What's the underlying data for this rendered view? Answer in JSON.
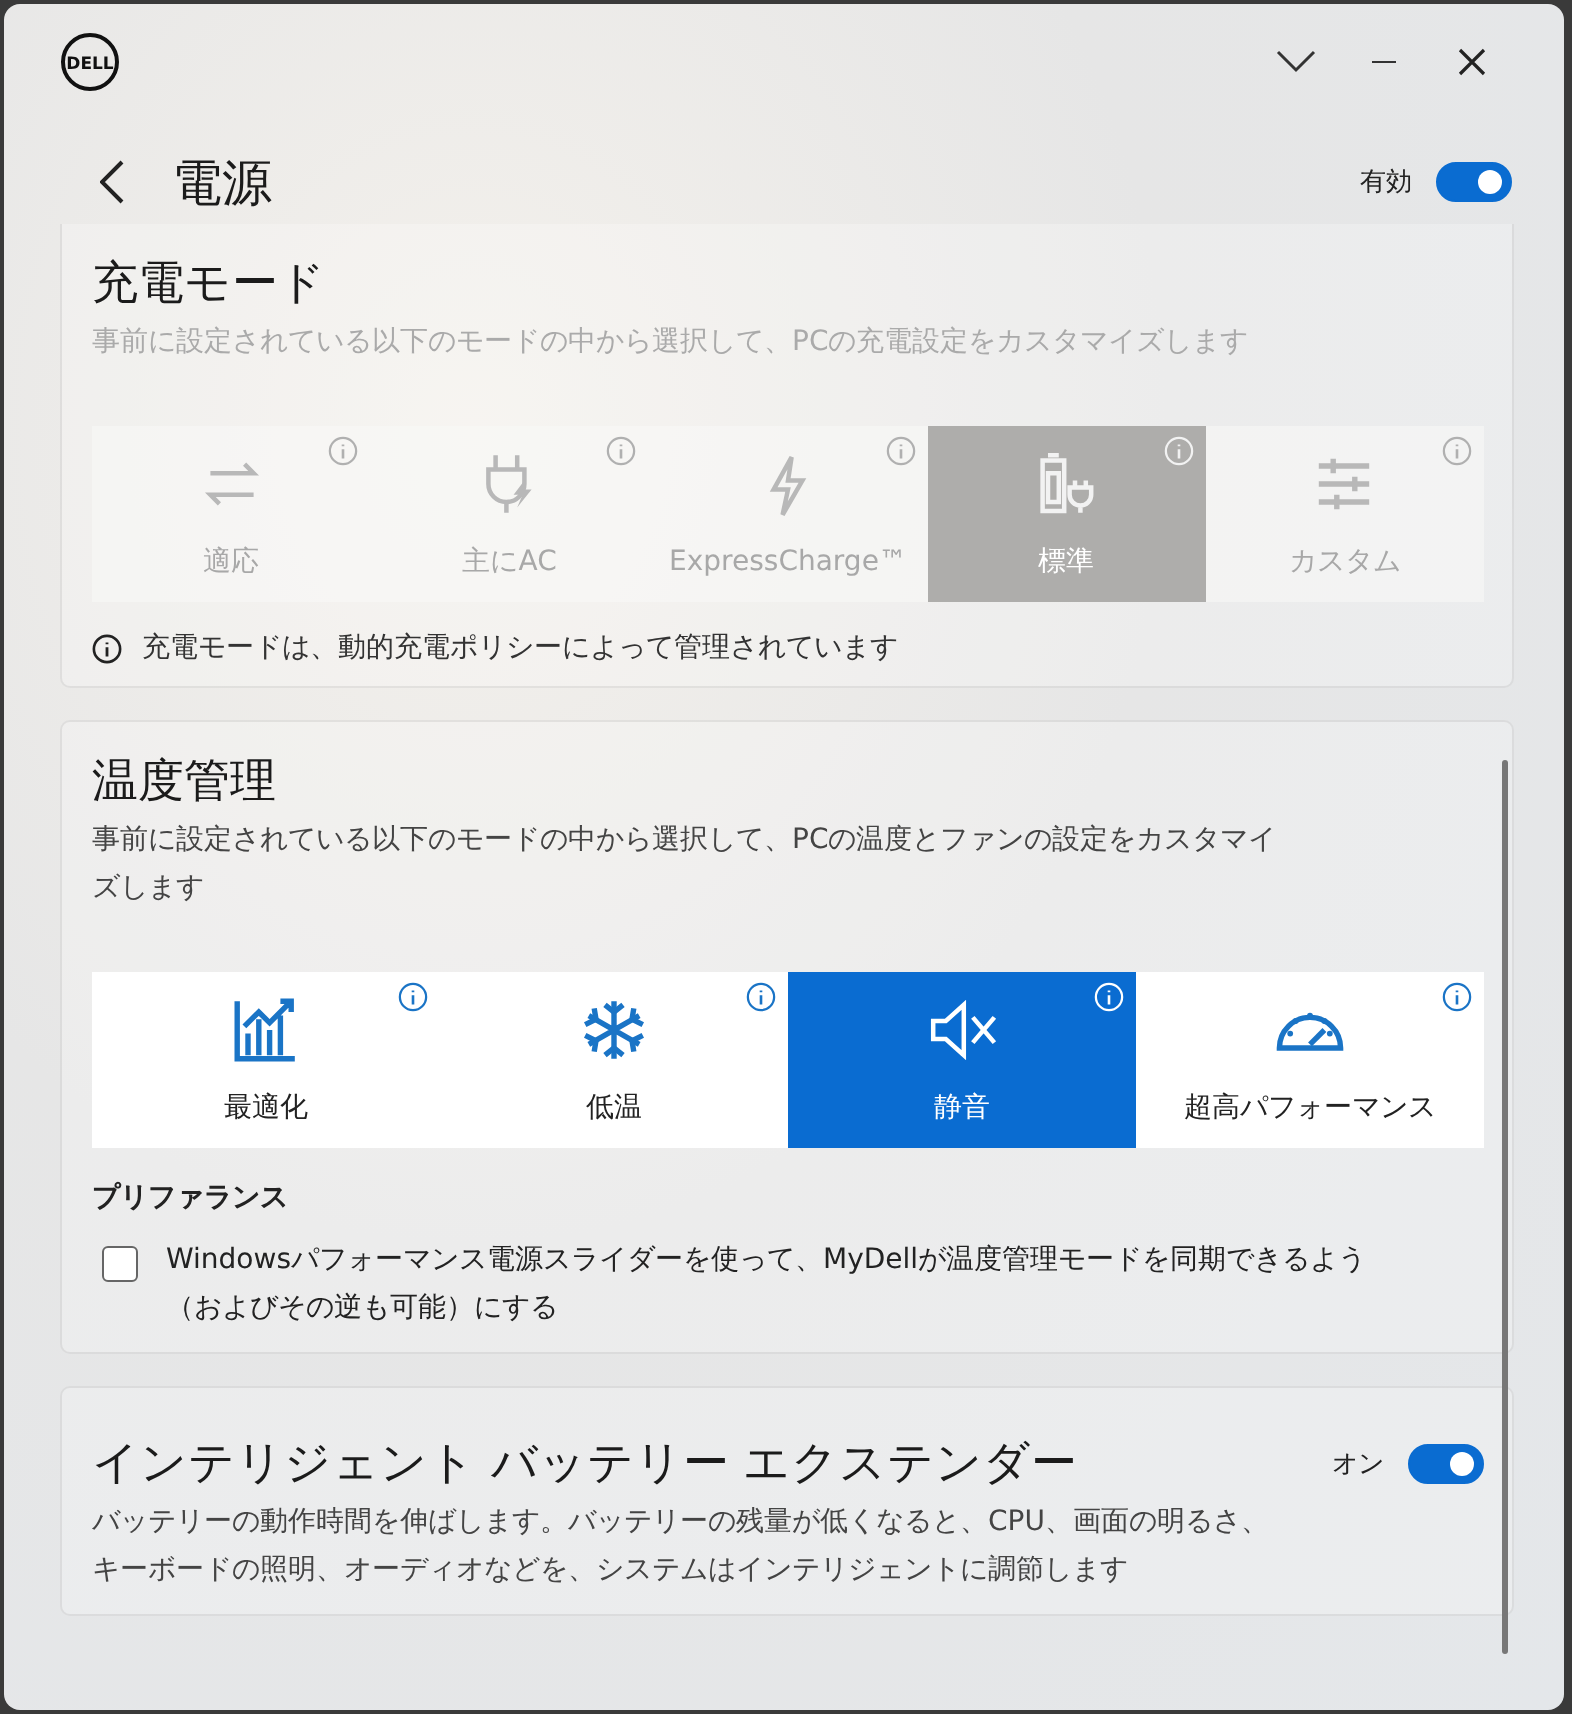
{
  "window": {
    "logo": "DELL"
  },
  "header": {
    "title": "電源",
    "toggle": {
      "label": "有効",
      "on": true
    }
  },
  "charging_mode": {
    "title": "充電モード",
    "description": "事前に設定されている以下のモードの中から選択して、PCの充電設定をカスタマイズします",
    "disabled": true,
    "modes": [
      {
        "label": "適応",
        "selected": false
      },
      {
        "label": "主にAC",
        "selected": false
      },
      {
        "label": "ExpressCharge™",
        "selected": false
      },
      {
        "label": "標準",
        "selected": true
      },
      {
        "label": "カスタム",
        "selected": false
      }
    ],
    "note": "充電モードは、動的充電ポリシーによって管理されています"
  },
  "thermal_management": {
    "title": "温度管理",
    "description": "事前に設定されている以下のモードの中から選択して、PCの温度とファンの設定をカスタマイズします",
    "modes": [
      {
        "label": "最適化",
        "selected": false
      },
      {
        "label": "低温",
        "selected": false
      },
      {
        "label": "静音",
        "selected": true
      },
      {
        "label": "超高パフォーマンス",
        "selected": false
      }
    ],
    "preference": {
      "heading": "プリファランス",
      "checkbox": {
        "label": "Windowsパフォーマンス電源スライダーを使って、MyDellが温度管理モードを同期できるよう（およびその逆も可能）にする",
        "checked": false
      }
    }
  },
  "battery_extender": {
    "title": "インテリジェント バッテリー エクステンダー",
    "description": "バッテリーの動作時間を伸ばします。バッテリーの残量が低くなると、CPU、画面の明るさ、キーボードの照明、オーディオなどを、システムはインテリジェントに調節します",
    "toggle": {
      "label": "オン",
      "on": true
    }
  }
}
